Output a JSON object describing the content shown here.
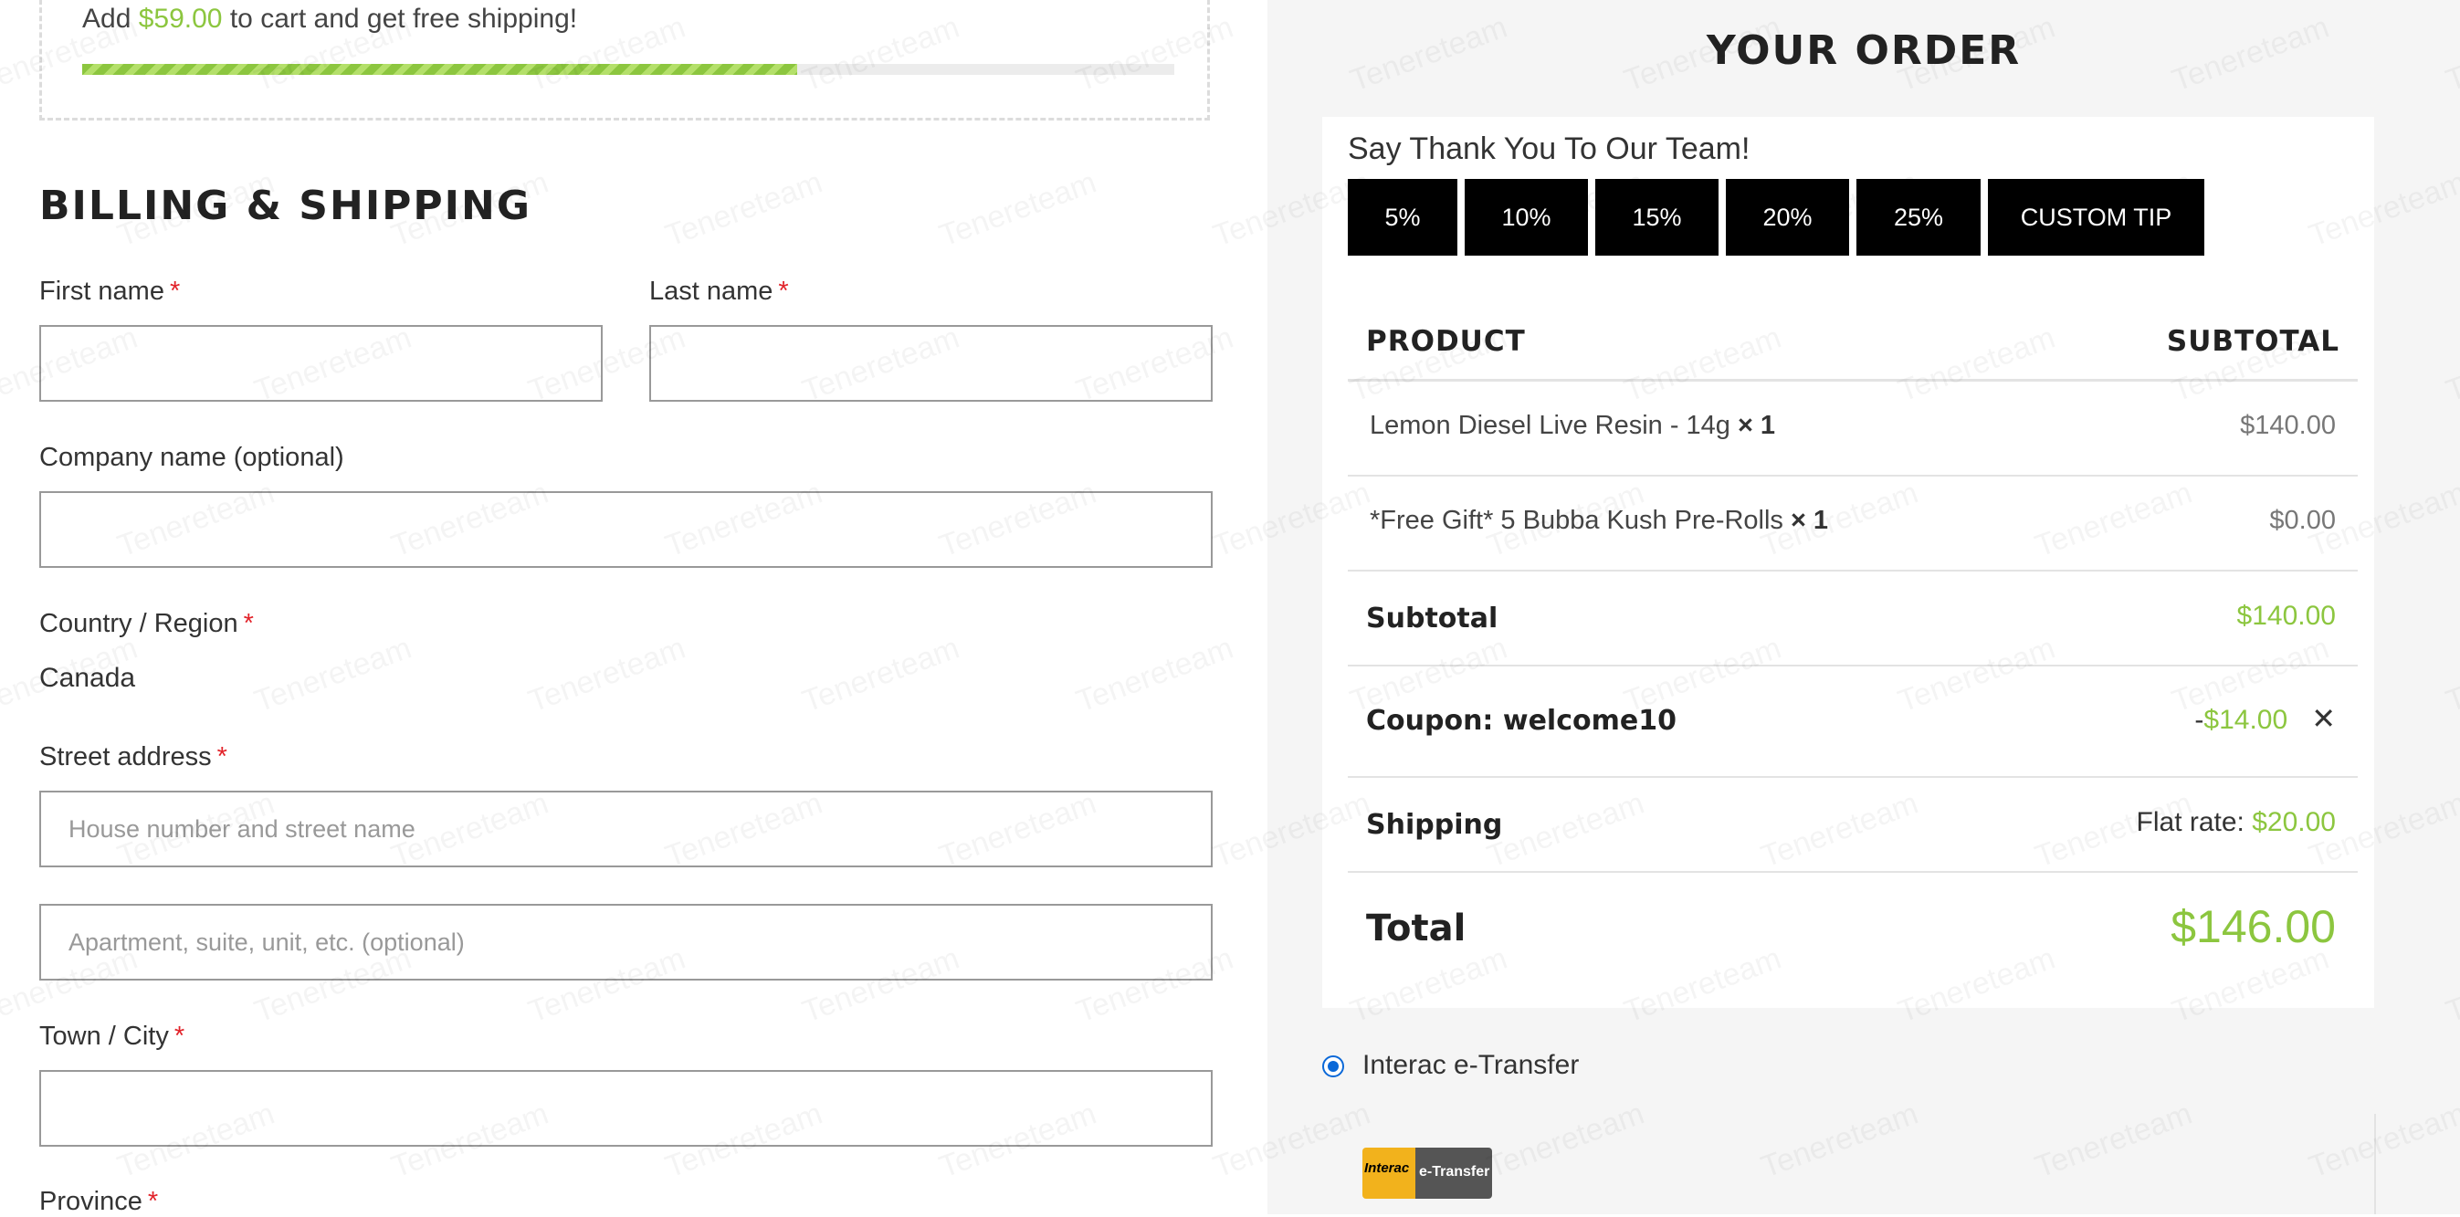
{
  "shipping_notice": {
    "prefix": "Add",
    "amount": "$59.00",
    "suffix": "to cart and get free shipping!",
    "progress_fraction": 0.655
  },
  "billing": {
    "title": "BILLING & SHIPPING",
    "first_name_label": "First name",
    "last_name_label": "Last name",
    "company_label": "Company name (optional)",
    "country_label": "Country / Region",
    "country_value": "Canada",
    "street_label": "Street address",
    "street_placeholder": "House number and street name",
    "apartment_placeholder": "Apartment, suite, unit, etc. (optional)",
    "city_label": "Town / City",
    "province_label": "Province",
    "required_mark": "*"
  },
  "order": {
    "title": "YOUR ORDER",
    "tip_title": "Say Thank You To Our Team!",
    "tip_buttons": [
      "5%",
      "10%",
      "15%",
      "20%",
      "25%",
      "CUSTOM TIP"
    ],
    "col_product": "PRODUCT",
    "col_subtotal": "SUBTOTAL",
    "items": [
      {
        "name": "Lemon Diesel Live Resin - 14g",
        "qty": "× 1",
        "price": "$140.00"
      },
      {
        "name": "*Free Gift* 5 Bubba Kush Pre-Rolls",
        "qty": "× 1",
        "price": "$0.00"
      }
    ],
    "subtotal_label": "Subtotal",
    "subtotal_value": "$140.00",
    "coupon_label": "Coupon: welcome10",
    "coupon_minus": "-",
    "coupon_value": "$14.00",
    "coupon_remove": "✕",
    "shipping_label": "Shipping",
    "shipping_method": "Flat rate:",
    "shipping_value": "$20.00",
    "total_label": "Total",
    "total_value": "$146.00"
  },
  "payment": {
    "method_label": "Interac e-Transfer",
    "logo_left": "Interac",
    "logo_right": "e-Transfer"
  },
  "watermark": "Tenereteam",
  "colors": {
    "accent": "#8cc63f",
    "required": "#e2232a",
    "button": "#000000",
    "radio": "#0a68d8"
  }
}
